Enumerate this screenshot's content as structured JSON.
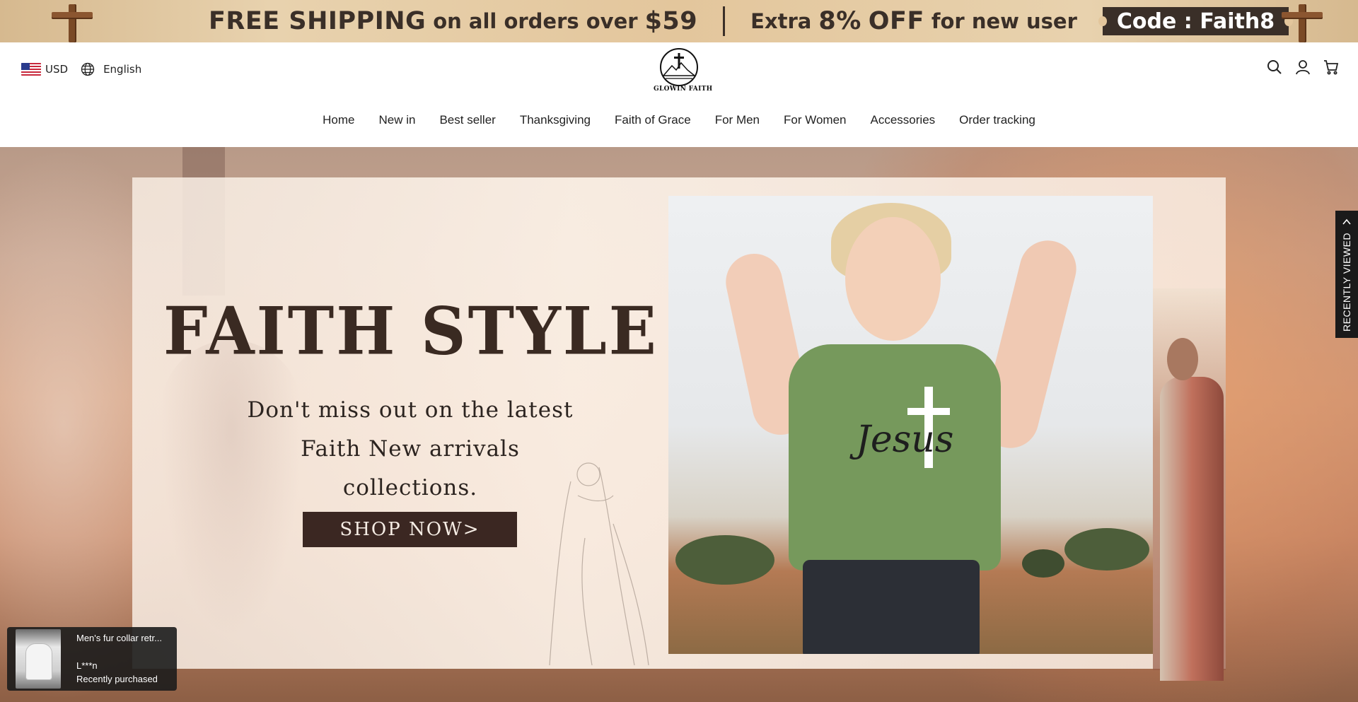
{
  "promo": {
    "part1": "FREE SHIPPING",
    "part2": "on all orders over",
    "part3": "$59",
    "part4": "Extra",
    "part5": "8%",
    "part6": "OFF",
    "part7": "for new user",
    "code": "Code : Faith8"
  },
  "header": {
    "currency": "USD",
    "language": "English",
    "logo_text": "GLOWIN FAITH",
    "icons": [
      "search-icon",
      "account-icon",
      "cart-icon"
    ]
  },
  "nav": {
    "items": [
      {
        "label": "Home"
      },
      {
        "label": "New in"
      },
      {
        "label": "Best seller"
      },
      {
        "label": "Thanksgiving"
      },
      {
        "label": "Faith of Grace"
      },
      {
        "label": "For Men"
      },
      {
        "label": "For Women"
      },
      {
        "label": "Accessories"
      },
      {
        "label": "Order tracking"
      }
    ]
  },
  "hero": {
    "title": "FAITH STYLE",
    "subtitle_line1": "Don't miss out on the latest",
    "subtitle_line2": "Faith New arrivals collections.",
    "cta": "SHOP NOW>",
    "shirt_text": "Jesus"
  },
  "recently_viewed": {
    "label": "RECENTLY VIEWED"
  },
  "purchase_popup": {
    "product": "Men's fur collar retr...",
    "customer": "L***n",
    "status": "Recently purchased"
  },
  "colors": {
    "accent_dark": "#3b2722",
    "promo_bg": "#e3c69c",
    "tab_bg": "#1a1a1a"
  }
}
